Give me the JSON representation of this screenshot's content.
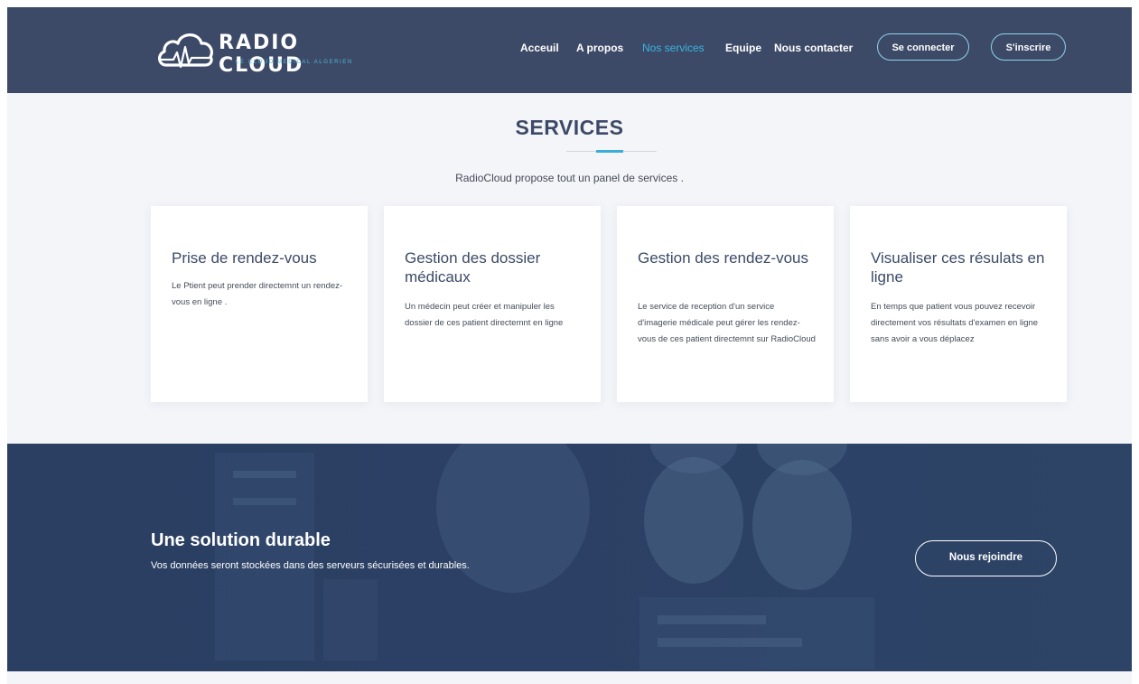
{
  "brand": {
    "name": "RADIO CLOUD",
    "tagline": "LE CLOUD MEDICAL ALGERIEN",
    "accent_color": "#3ab4e0",
    "header_color": "#3c4a67"
  },
  "nav": {
    "items": [
      {
        "label": "Acceuil"
      },
      {
        "label": "A propos"
      },
      {
        "label": "Nos services"
      },
      {
        "label": "Equipe"
      },
      {
        "label": "Nous contacter"
      }
    ],
    "active": "Nos services",
    "login_label": "Se connecter",
    "signup_label": "S'inscrire"
  },
  "services": {
    "title": "SERVICES",
    "subtitle": "RadioCloud propose tout un panel de services .",
    "cards": [
      {
        "title": "Prise de rendez-vous",
        "text": "Le Ptient peut prender directemnt un rendez-vous en ligne ."
      },
      {
        "title": "Gestion des dossier médicaux",
        "text": "Un médecin peut créer et manipuler les dossier de ces patient directemnt en ligne"
      },
      {
        "title": "Gestion des rendez-vous",
        "text": "Le service de reception d'un service d'imagerie médicale peut gérer les rendez-vous de ces patient directemnt sur RadioCloud"
      },
      {
        "title": "Visualiser ces résulats en ligne",
        "text": "En temps que patient vous pouvez recevoir directement vos résultats d'examen en ligne sans avoir a vous déplacez"
      }
    ]
  },
  "banner": {
    "title": "Une solution durable",
    "text": "Vos données seront stockées dans des serveurs sécurisées et durables.",
    "button_label": "Nous rejoindre"
  }
}
